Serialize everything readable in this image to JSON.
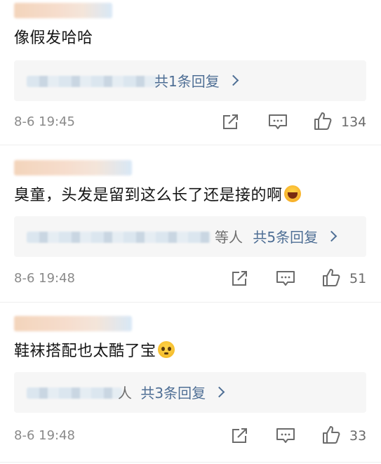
{
  "comments": [
    {
      "text": "像假发哈哈",
      "reply_label": "共1条回复",
      "reply_who": "",
      "time": "8-6 19:45",
      "likes": "134"
    },
    {
      "text": "臭童，头发是留到这么长了还是接的啊",
      "emoji": "laughing-emoji",
      "reply_label": "共5条回复",
      "reply_who": "等人",
      "time": "8-6 19:48",
      "likes": "51"
    },
    {
      "text": "鞋袜搭配也太酷了宝",
      "emoji": "pleading-emoji",
      "reply_label": "共3条回复",
      "reply_who": "人",
      "time": "8-6 19:48",
      "likes": "33"
    }
  ],
  "icons": {
    "share": "share-icon",
    "comment": "comment-icon",
    "like": "thumbs-up-icon"
  },
  "colors": {
    "link": "#4f6f95",
    "meta": "#8a8a8a",
    "reply_bg": "#f6f6f6"
  }
}
